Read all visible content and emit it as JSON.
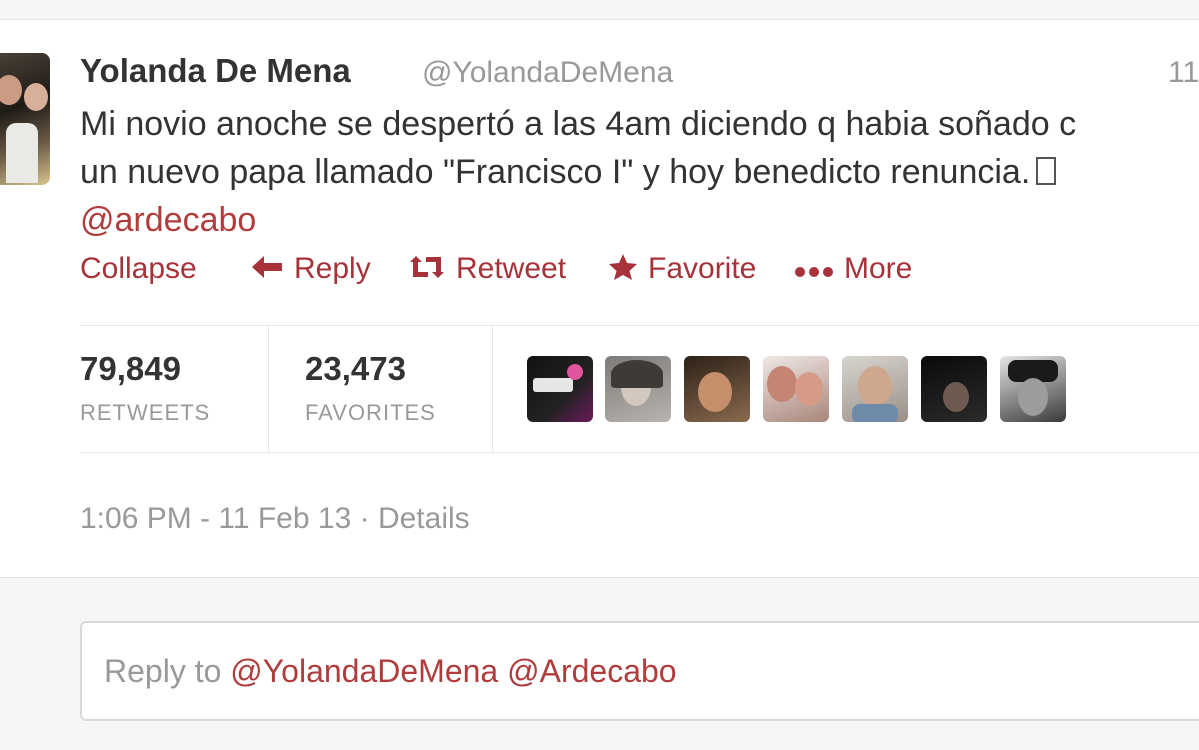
{
  "tweet": {
    "author_name": "Yolanda De Mena",
    "author_handle": "@YolandaDeMena",
    "timestamp_short": "11",
    "text_line1": "Mi novio anoche se despertó a las 4am diciendo q habia soñado c",
    "text_line2": "un nuevo papa llamado \"Francisco I\" y hoy benedicto renuncia.",
    "mention": "@ardecabo"
  },
  "actions": {
    "collapse": "Collapse",
    "reply": "Reply",
    "retweet": "Retweet",
    "favorite": "Favorite",
    "more": "More"
  },
  "stats": {
    "retweets_count": "79,849",
    "retweets_label": "RETWEETS",
    "favorites_count": "23,473",
    "favorites_label": "FAVORITES"
  },
  "meta": {
    "datetime": "1:06 PM - 11 Feb 13",
    "separator": "·",
    "details": "Details"
  },
  "reply_box": {
    "prefix": "Reply to",
    "mention1": "@YolandaDeMena",
    "mention2": "@Ardecabo"
  },
  "colors": {
    "accent": "#b13c3c",
    "muted": "#999999",
    "text": "#333333"
  },
  "icons": [
    "reply-arrow-icon",
    "retweet-icon",
    "star-icon",
    "more-dots-icon"
  ]
}
